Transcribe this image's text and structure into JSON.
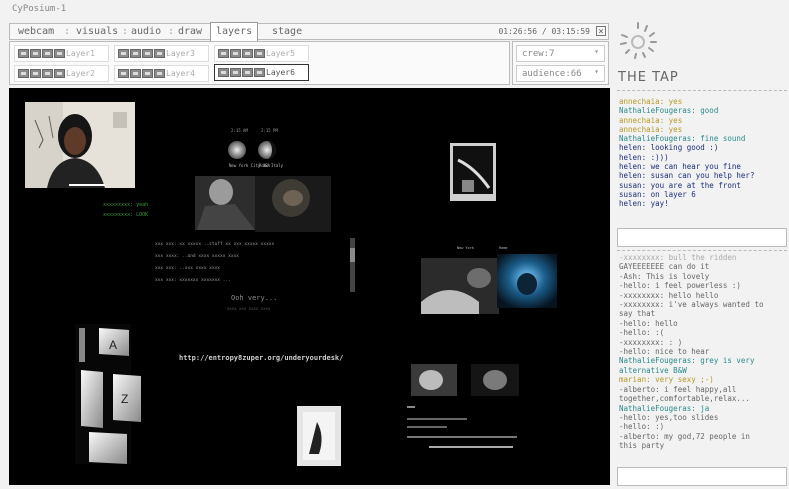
{
  "app": {
    "title": "CyPosium-1"
  },
  "tabs": [
    {
      "label": "webcam"
    },
    {
      "label": "visuals"
    },
    {
      "label": "audio"
    },
    {
      "label": "draw"
    },
    {
      "label": "layers"
    },
    {
      "label": "stage"
    }
  ],
  "tab_separator": ":",
  "timecode": "01:26:56 / 03:15:59",
  "close_glyph": "×",
  "layers": [
    {
      "name": "Layer1"
    },
    {
      "name": "Layer2"
    },
    {
      "name": "Layer3"
    },
    {
      "name": "Layer4"
    },
    {
      "name": "Layer5"
    },
    {
      "name": "Layer6",
      "selected": true
    }
  ],
  "crew": {
    "value": "crew:7"
  },
  "audience": {
    "value": "audience:66"
  },
  "dropdown_arrow": "▾",
  "brand": {
    "name": "THE TAP"
  },
  "chat_top": [
    {
      "text": "annechaia: yes",
      "color": "yellow"
    },
    {
      "text": "NathalieFougeras: good",
      "color": "teal"
    },
    {
      "text": "annechaia: yes",
      "color": "yellow"
    },
    {
      "text": "annechaia: yes",
      "color": "yellow"
    },
    {
      "text": "NathalieFougeras: fine sound",
      "color": "teal"
    },
    {
      "text": "helen: looking good :)",
      "color": "navy"
    },
    {
      "text": "helen: :)))",
      "color": "navy"
    },
    {
      "text": "helen: we can hear you fine",
      "color": "navy"
    },
    {
      "text": "helen: susan can you help her?",
      "color": "navy"
    },
    {
      "text": "susan: you are at the front",
      "color": "navy"
    },
    {
      "text": "susan: on layer 6",
      "color": "navy"
    },
    {
      "text": "helen: yay!",
      "color": "navy"
    }
  ],
  "chat_bottom": [
    {
      "text": "-xxxxxxxx: bull the ridden",
      "color": "faded"
    },
    {
      "text": "GAYEEEEEEE can do it",
      "color": "gray"
    },
    {
      "text": "-Ash: This is lovely",
      "color": "gray"
    },
    {
      "text": "-hello: i feel powerless :)",
      "color": "gray"
    },
    {
      "text": "-xxxxxxxx: hello hello",
      "color": "gray"
    },
    {
      "text": "-xxxxxxxx: i've always wanted to",
      "color": "gray"
    },
    {
      "text": "say that",
      "color": "gray"
    },
    {
      "text": "-hello: hello",
      "color": "gray"
    },
    {
      "text": "-hello: :(",
      "color": "gray"
    },
    {
      "text": "-xxxxxxxx: : )",
      "color": "gray"
    },
    {
      "text": "-hello: nice to hear",
      "color": "gray"
    },
    {
      "text": "NathalieFougeras: grey is very",
      "color": "teal"
    },
    {
      "text": "alternative B&W",
      "color": "teal"
    },
    {
      "text": "marian: very sexy ;-)",
      "color": "yellow"
    },
    {
      "text": "-alberto: i feel happy,all",
      "color": "gray"
    },
    {
      "text": "together,comfortable,relax...",
      "color": "gray"
    },
    {
      "text": "NathalieFougeras: ja",
      "color": "teal"
    },
    {
      "text": "-hello: yes,too slides",
      "color": "gray"
    },
    {
      "text": "-hello: :)",
      "color": "gray"
    },
    {
      "text": "-alberto: my god,72 people in",
      "color": "gray"
    },
    {
      "text": "this party",
      "color": "gray"
    }
  ],
  "stage": {
    "url_text": "http://entropy8zuper.org/underyourdesk/",
    "green_lines": [
      "xxxxxxxxx: yeah",
      "xxxxxxxxx: LOOK"
    ],
    "center_text": [
      "Ooh very...",
      "xxxx xxx xxxx xxxx"
    ],
    "key_letters": [
      "A",
      "Z"
    ],
    "moon_labels": [
      "New York City USA",
      "Rome Italy"
    ],
    "small_labels": [
      "New York",
      "Rome"
    ],
    "moon_times": [
      "2:15 AM",
      "2:15 PM"
    ],
    "chat_lines": [
      "xxx xxx: xx xxxxx ..stuff xx xxx xxxxx xxxxx",
      "xxx xxxx: ..and xxxx xxxxx xxxx",
      "xxx xxx: ..xxx xxxx xxxx",
      "xxx xxx: xxxxxxx xxxxxxx ..."
    ]
  }
}
